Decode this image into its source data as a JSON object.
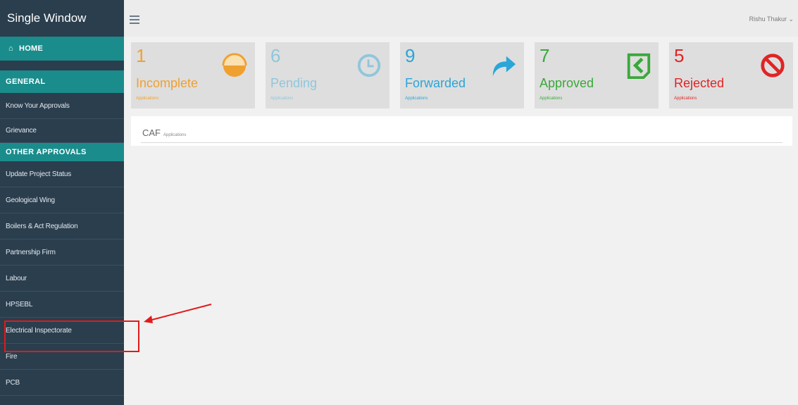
{
  "app": {
    "brand": "Single Window"
  },
  "header": {
    "user_name": "Rishu Thakur ⌄"
  },
  "sidebar": {
    "home": "HOME",
    "general_header": "GENERAL",
    "general_items": [
      "Know Your Approvals",
      "Grievance"
    ],
    "other_header": "OTHER APPROVALS",
    "other_items": [
      "Update Project Status",
      "Geological Wing",
      "Boilers & Act Regulation",
      "Partnership Firm",
      "Labour",
      "HPSEBL",
      "Electrical Inspectorate",
      "Fire",
      "PCB"
    ]
  },
  "cards": [
    {
      "count": "1",
      "label": "Incomplete",
      "sub": "Applications",
      "color": "#f0a030",
      "icon": "half-circle-icon"
    },
    {
      "count": "6",
      "label": "Pending",
      "sub": "Applications",
      "color": "#8fc6dc",
      "icon": "clock-icon"
    },
    {
      "count": "9",
      "label": "Forwarded",
      "sub": "Applications",
      "color": "#2aa6d8",
      "icon": "forward-arrow-icon"
    },
    {
      "count": "7",
      "label": "Approved",
      "sub": "Applications",
      "color": "#3aa83a",
      "icon": "approved-check-icon"
    },
    {
      "count": "5",
      "label": "Rejected",
      "sub": "Applications",
      "color": "#e02424",
      "icon": "prohibited-icon"
    }
  ],
  "caf": {
    "title": "CAF",
    "subtitle": "Applications"
  },
  "colors": {
    "sidebar": "#2a3e4e",
    "accent": "#1a8c8c",
    "highlight": "#e11a1a"
  }
}
